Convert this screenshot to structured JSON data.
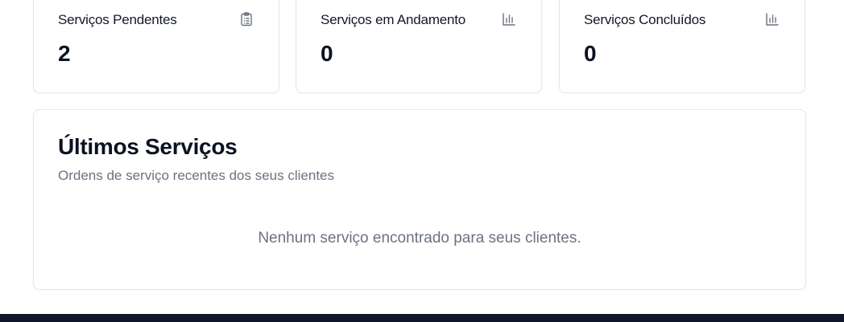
{
  "stats": [
    {
      "title": "Serviços Pendentes",
      "value": "2",
      "icon": "clipboard-list-icon"
    },
    {
      "title": "Serviços em Andamento",
      "value": "0",
      "icon": "bar-chart-icon"
    },
    {
      "title": "Serviços Concluídos",
      "value": "0",
      "icon": "bar-chart-icon"
    }
  ],
  "recent": {
    "title": "Últimos Serviços",
    "subtitle": "Ordens de serviço recentes dos seus clientes",
    "empty_message": "Nenhum serviço encontrado para seus clientes."
  },
  "colors": {
    "card_border": "#e5e7eb",
    "text_primary": "#0b1220",
    "text_muted": "#6b7280",
    "icon": "#6b7280",
    "footer": "#0f172a"
  }
}
